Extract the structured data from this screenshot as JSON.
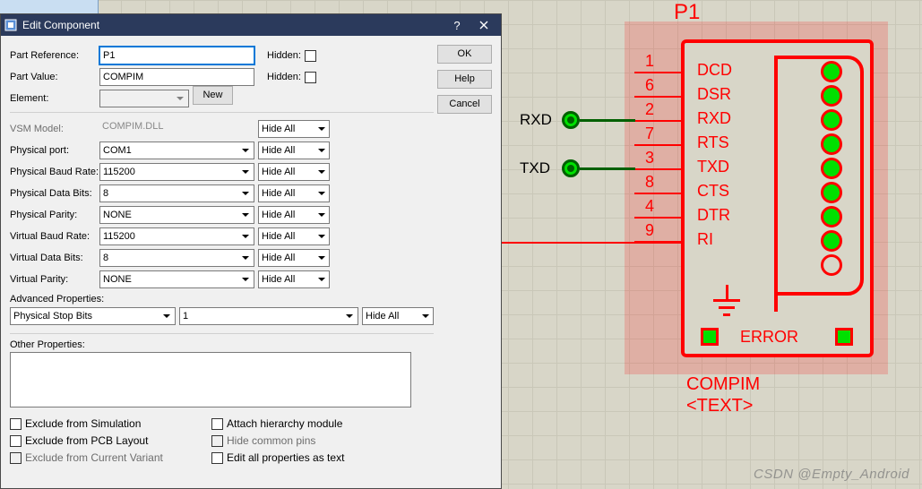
{
  "dialog": {
    "title": "Edit Component",
    "buttons": {
      "ok": "OK",
      "help": "Help",
      "cancel": "Cancel"
    },
    "new_btn": "New",
    "hidden_lbl": "Hidden:",
    "labels": {
      "part_ref": "Part Reference:",
      "part_value": "Part Value:",
      "element": "Element:",
      "vsm_model": "VSM Model:",
      "phy_port": "Physical port:",
      "phy_baud": "Physical Baud Rate:",
      "phy_bits": "Physical Data Bits:",
      "phy_parity": "Physical Parity:",
      "vir_baud": "Virtual Baud Rate:",
      "vir_bits": "Virtual Data Bits:",
      "vir_parity": "Virtual Parity:",
      "adv_props": "Advanced Properties:",
      "other_props": "Other Properties:"
    },
    "values": {
      "part_ref": "P1",
      "part_value": "COMPIM",
      "vsm_model": "COMPIM.DLL",
      "phy_port": "COM1",
      "phy_baud": "115200",
      "phy_bits": "8",
      "phy_parity": "NONE",
      "vir_baud": "115200",
      "vir_bits": "8",
      "vir_parity": "NONE",
      "adv_prop_name": "Physical Stop Bits",
      "adv_prop_val": "1"
    },
    "visibility": "Hide All",
    "checks": {
      "c1": "Exclude from Simulation",
      "c2": "Exclude from PCB Layout",
      "c3": "Exclude from Current Variant",
      "c4": "Attach hierarchy module",
      "c5": "Hide common pins",
      "c6": "Edit all properties as text"
    }
  },
  "component": {
    "ref": "P1",
    "value": "COMPIM",
    "placeholder": "<TEXT>",
    "error": "ERROR",
    "pins": [
      {
        "num": "1",
        "name": "DCD"
      },
      {
        "num": "6",
        "name": "DSR"
      },
      {
        "num": "2",
        "name": "RXD"
      },
      {
        "num": "7",
        "name": "RTS"
      },
      {
        "num": "3",
        "name": "TXD"
      },
      {
        "num": "8",
        "name": "CTS"
      },
      {
        "num": "4",
        "name": "DTR"
      },
      {
        "num": "9",
        "name": "RI"
      }
    ],
    "ext": {
      "rxd": "RXD",
      "txd": "TXD"
    }
  },
  "watermark": "CSDN @Empty_Android"
}
